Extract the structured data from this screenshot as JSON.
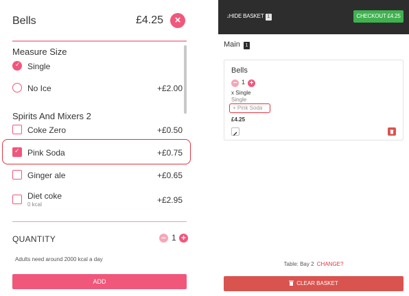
{
  "item": {
    "title": "Bells",
    "price": "£4.25",
    "close_icon": "×"
  },
  "options": {
    "measure": {
      "title": "Measure Size",
      "items": [
        {
          "label": "Single",
          "price": "",
          "selected": true,
          "input": "radio"
        },
        {
          "label": "No Ice",
          "price": "+£2.00",
          "selected": false,
          "input": "radio"
        }
      ]
    },
    "spirits": {
      "title": "Spirits And Mixers 2",
      "items": [
        {
          "label": "Coke Zero",
          "price": "+£0.50",
          "selected": false,
          "input": "checkbox"
        },
        {
          "label": "Pink Soda",
          "price": "+£0.75",
          "selected": true,
          "input": "checkbox"
        },
        {
          "label": "Ginger ale",
          "price": "+£0.65",
          "selected": false,
          "input": "checkbox"
        },
        {
          "label": "Diet coke",
          "sublabel": "0 kcal",
          "price": "+£2.95",
          "selected": false,
          "input": "checkbox"
        }
      ]
    }
  },
  "quantity": {
    "label": "QUANTITY",
    "value": "1",
    "minus": "−",
    "plus": "+"
  },
  "kcal_note": "Adults need around 2000 kcal a day",
  "add_label": "ADD",
  "basket": {
    "hide_label": "↓HIDE BASKET",
    "count": "1",
    "checkout_label": "CHECKOUT £4.25",
    "section": "Main",
    "section_count": "1",
    "card": {
      "title": "Bells",
      "qty": "1",
      "minus": "−",
      "plus": "+",
      "line1": "x Single",
      "line2": "Single",
      "extra": "+ Pink Soda",
      "price": "£4.25"
    },
    "table_text": "Table: Bay 2",
    "change_label": "CHANGE?",
    "clear_label": "CLEAR BASKET"
  },
  "colors": {
    "accent": "#f0577a",
    "highlight": "#e0333f",
    "checkout": "#3fb14f",
    "danger": "#d9534f",
    "topbar": "#2d2d2d"
  },
  "icons": [
    "close-icon",
    "check-icon",
    "minus-icon",
    "plus-icon",
    "edit-icon",
    "trash-icon"
  ]
}
